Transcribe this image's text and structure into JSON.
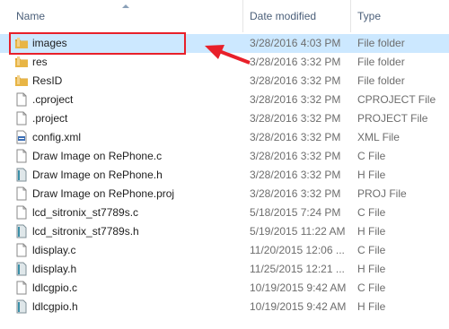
{
  "header": {
    "name": "Name",
    "date": "Date modified",
    "type": "Type"
  },
  "rows": [
    {
      "name": "images",
      "date": "3/28/2016 4:03 PM",
      "type": "File folder",
      "icon": "folder-icon"
    },
    {
      "name": "res",
      "date": "3/28/2016 3:32 PM",
      "type": "File folder",
      "icon": "folder-icon"
    },
    {
      "name": "ResID",
      "date": "3/28/2016 3:32 PM",
      "type": "File folder",
      "icon": "folder-icon"
    },
    {
      "name": ".cproject",
      "date": "3/28/2016 3:32 PM",
      "type": "CPROJECT File",
      "icon": "file-icon"
    },
    {
      "name": ".project",
      "date": "3/28/2016 3:32 PM",
      "type": "PROJECT File",
      "icon": "file-icon"
    },
    {
      "name": "config.xml",
      "date": "3/28/2016 3:32 PM",
      "type": "XML File",
      "icon": "xml-file-icon"
    },
    {
      "name": "Draw Image on RePhone.c",
      "date": "3/28/2016 3:32 PM",
      "type": "C File",
      "icon": "file-icon"
    },
    {
      "name": "Draw Image on RePhone.h",
      "date": "3/28/2016 3:32 PM",
      "type": "H File",
      "icon": "header-file-icon"
    },
    {
      "name": "Draw Image on RePhone.proj",
      "date": "3/28/2016 3:32 PM",
      "type": "PROJ File",
      "icon": "file-icon"
    },
    {
      "name": "lcd_sitronix_st7789s.c",
      "date": "5/18/2015 7:24 PM",
      "type": "C File",
      "icon": "file-icon"
    },
    {
      "name": "lcd_sitronix_st7789s.h",
      "date": "5/19/2015 11:22 AM",
      "type": "H File",
      "icon": "header-file-icon"
    },
    {
      "name": "ldisplay.c",
      "date": "11/20/2015 12:06 ...",
      "type": "C File",
      "icon": "file-icon"
    },
    {
      "name": "ldisplay.h",
      "date": "11/25/2015 12:21 ...",
      "type": "H File",
      "icon": "header-file-icon"
    },
    {
      "name": "ldlcgpio.c",
      "date": "10/19/2015 9:42 AM",
      "type": "C File",
      "icon": "file-icon"
    },
    {
      "name": "ldlcgpio.h",
      "date": "10/19/2015 9:42 AM",
      "type": "H File",
      "icon": "header-file-icon"
    }
  ],
  "selected_index": 0,
  "colors": {
    "selection": "#cce8ff",
    "highlight": "#e8202a",
    "folder": "#e8b545"
  }
}
